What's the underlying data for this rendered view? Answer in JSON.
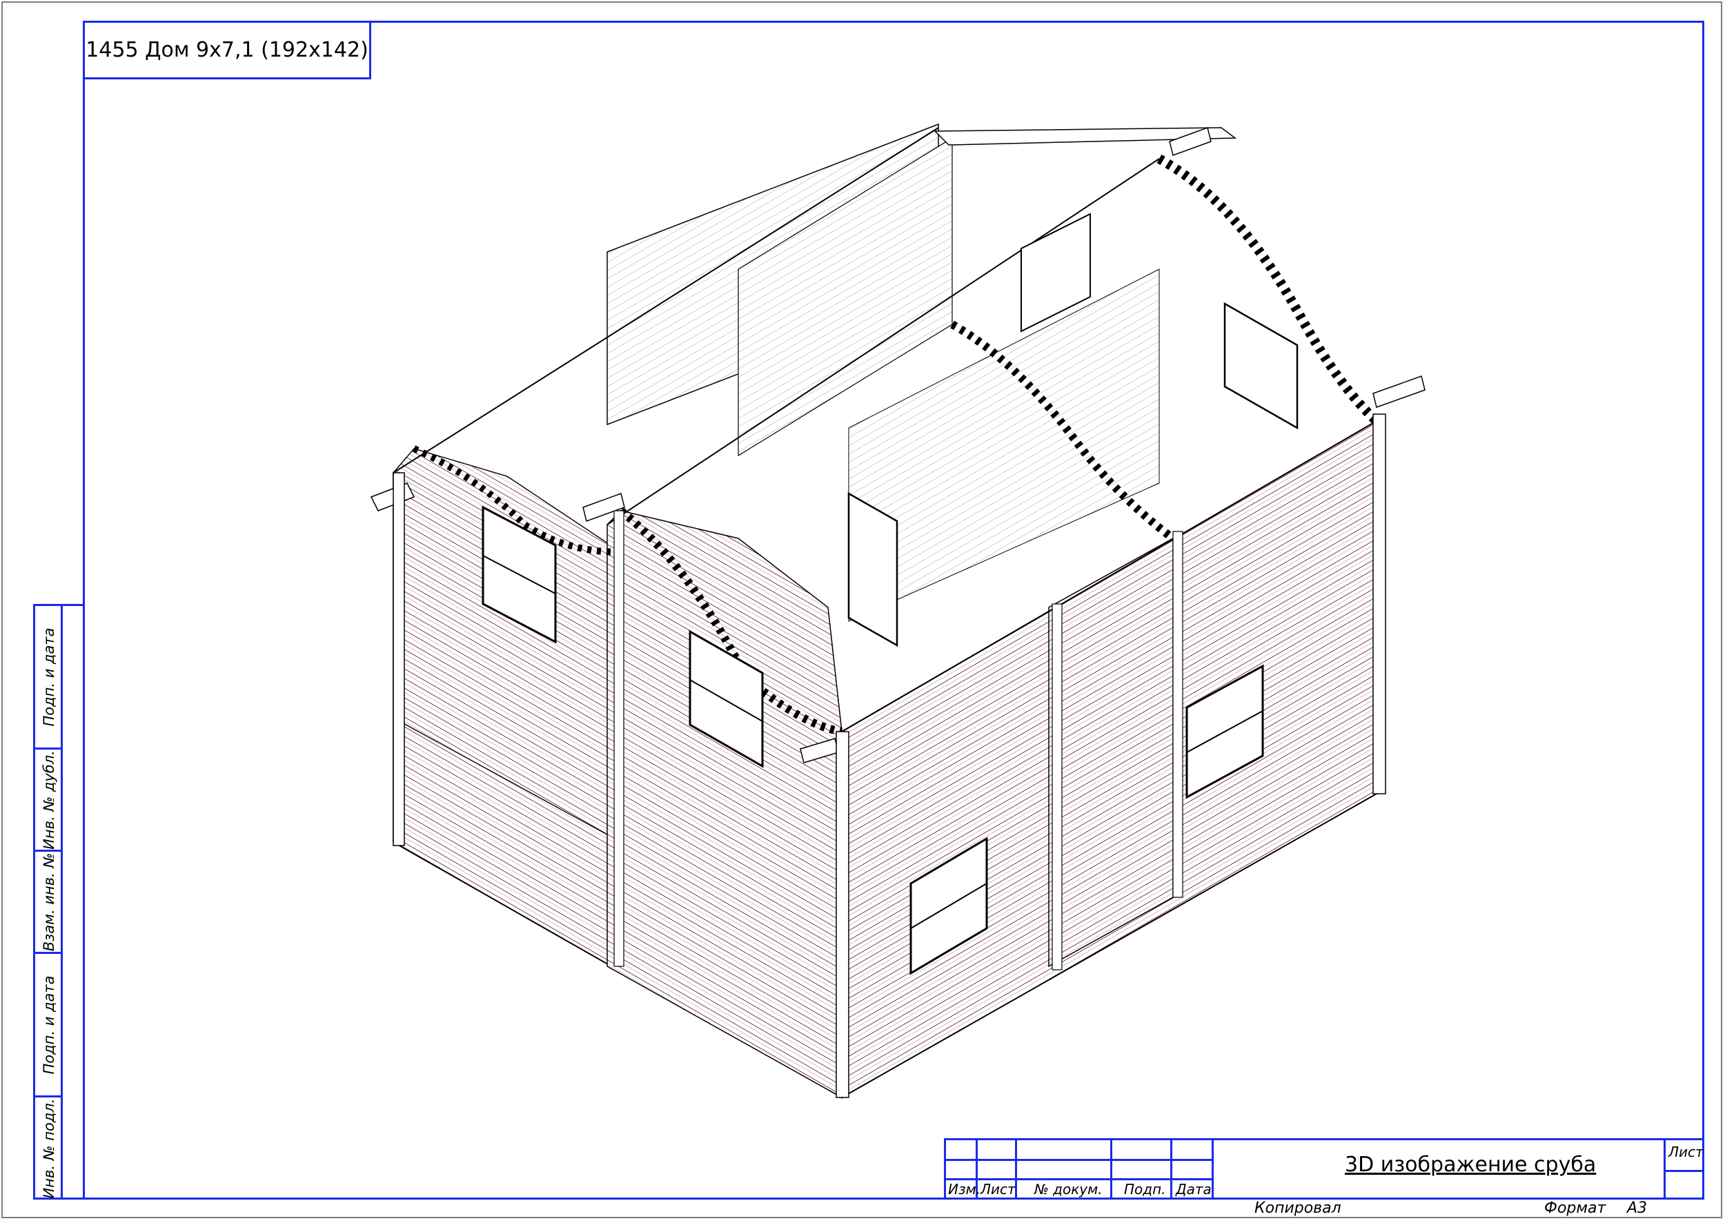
{
  "sheet": {
    "title": "1455 Дом 9х7,1 (192х142)",
    "drawing_title": "3D изображение сруба",
    "sheet_label": "Лист",
    "copied_label": "Копировал",
    "format_label": "Формат",
    "format_value": "А3"
  },
  "stamp_columns": {
    "izm": "Изм.",
    "list": "Лист",
    "doc_no": "№ докум.",
    "sign": "Подп.",
    "date": "Дата"
  },
  "side_columns": [
    "Подп. и дата",
    "Инв. № дубл.",
    "Взам. инв. №",
    "Подп. и дата",
    "Инв. № подл."
  ],
  "colors": {
    "frame": "#1a2be8",
    "log_lines": "#7a1f1f",
    "outline": "#000000"
  }
}
